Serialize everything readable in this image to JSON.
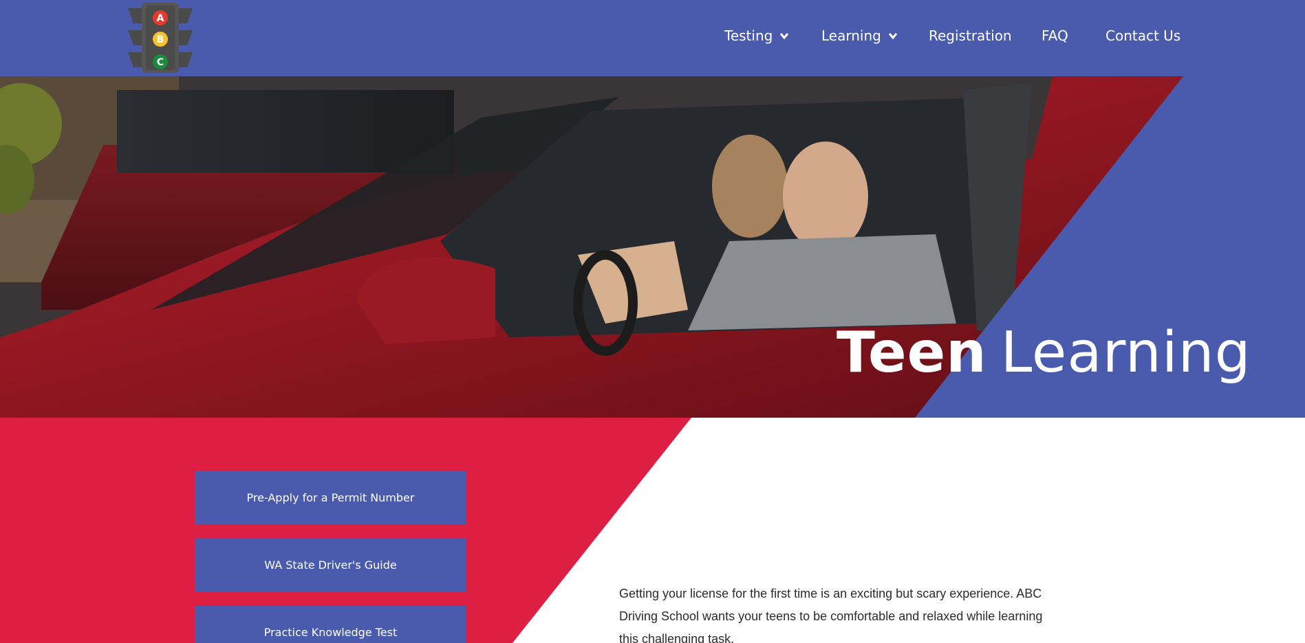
{
  "brand": {
    "logo_letters": [
      "A",
      "B",
      "C"
    ],
    "colors": {
      "header": "#4a5bad",
      "accent_red": "#dc1f42",
      "light_red": "#e53a2f",
      "light_yellow": "#f4c430",
      "light_green": "#1a8a3e"
    }
  },
  "nav": {
    "items": [
      {
        "label": "Testing",
        "has_dropdown": true,
        "icon": "chevron-down-icon"
      },
      {
        "label": "Learning",
        "has_dropdown": true,
        "icon": "chevron-down-icon"
      },
      {
        "label": "Registration",
        "has_dropdown": false
      },
      {
        "label": "FAQ",
        "has_dropdown": false
      },
      {
        "label": "Contact Us",
        "has_dropdown": false
      }
    ]
  },
  "hero": {
    "title_bold": "Teen",
    "title_light": "Learning"
  },
  "sidebar": {
    "buttons": [
      {
        "label": "Pre-Apply for a Permit Number"
      },
      {
        "label": "WA State Driver's Guide"
      },
      {
        "label": "Practice Knowledge Test"
      }
    ]
  },
  "content": {
    "intro": "Getting your license for the first time is an exciting but scary experience. ABC Driving School wants your teens to be comfortable and relaxed while learning this challenging task."
  }
}
